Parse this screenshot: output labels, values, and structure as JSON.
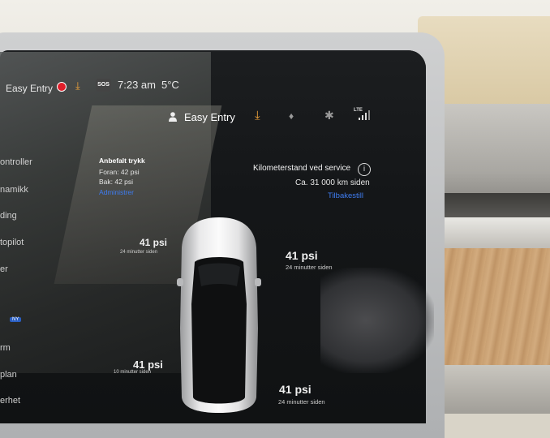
{
  "status_bar": {
    "profile": "Easy Entry",
    "sos": "SOS",
    "time": "7:23 am",
    "temperature": "5°C"
  },
  "header": {
    "profile_name": "Easy Entry",
    "network": "LTE"
  },
  "menu": {
    "items": [
      "ontroller",
      "namikk",
      "ding",
      "topilot",
      "er",
      "rm",
      "plan",
      "erhet"
    ],
    "new_badge": "NY"
  },
  "recommended_pressure": {
    "title": "Anbefalt trykk",
    "front": "Foran: 42 psi",
    "rear": "Bak: 42 psi",
    "manage_link": "Administrer"
  },
  "service": {
    "title": "Kilometerstand ved service",
    "distance": "Ca. 31 000 km siden",
    "reset_link": "Tilbakestill"
  },
  "tires": {
    "front_left": {
      "psi": "41 psi",
      "age": "24 minutter siden"
    },
    "front_right": {
      "psi": "41 psi",
      "age": "24 minutter siden"
    },
    "rear_left": {
      "psi": "41 psi",
      "age": "10 minutter siden"
    },
    "rear_right": {
      "psi": "41 psi",
      "age": "24 minutter siden"
    }
  },
  "colors": {
    "accent_link": "#3e7cf0",
    "download_orange": "#f0a33a",
    "record_red": "#e01e2a"
  }
}
